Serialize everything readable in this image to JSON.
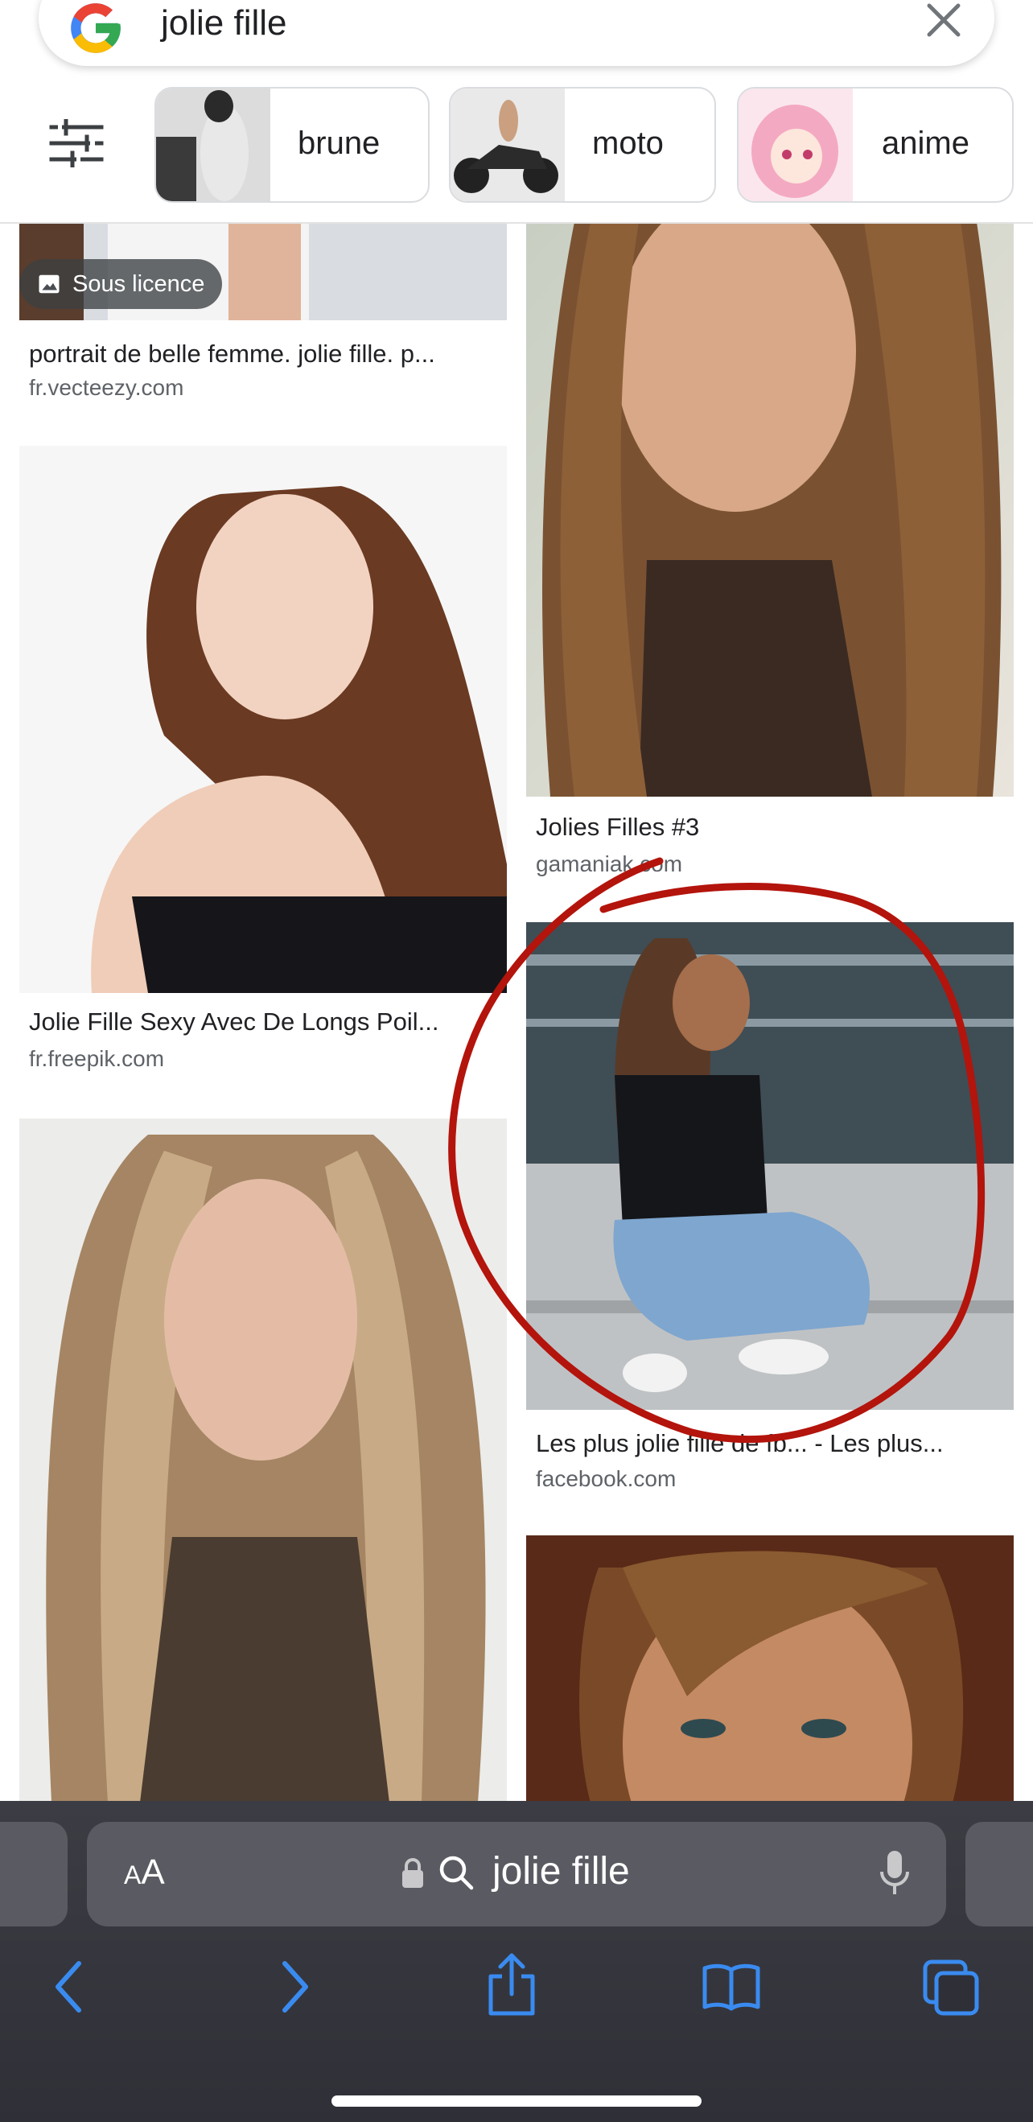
{
  "search": {
    "query": "jolie fille"
  },
  "chips": [
    {
      "label": "brune"
    },
    {
      "label": "moto"
    },
    {
      "label": "anime"
    }
  ],
  "results": [
    {
      "caption": "portrait de belle femme. jolie fille. p...",
      "source": "fr.vecteezy.com",
      "badge": "Sous licence"
    },
    {
      "caption": "Jolies Filles #3",
      "source": "gamaniak.com"
    },
    {
      "caption": "Jolie Fille Sexy Avec De Longs Poil...",
      "source": "fr.freepik.com"
    },
    {
      "caption": "Les plus jolie fille de fb... - Les plus...",
      "source": "facebook.com"
    }
  ],
  "safari": {
    "text_size_label_small": "A",
    "text_size_label_large": "A",
    "address_text": "jolie fille"
  },
  "colors": {
    "annotation": "#b3140c",
    "safari_icons": "#3a8bf0",
    "toolbar_bg": "#2f3037"
  }
}
